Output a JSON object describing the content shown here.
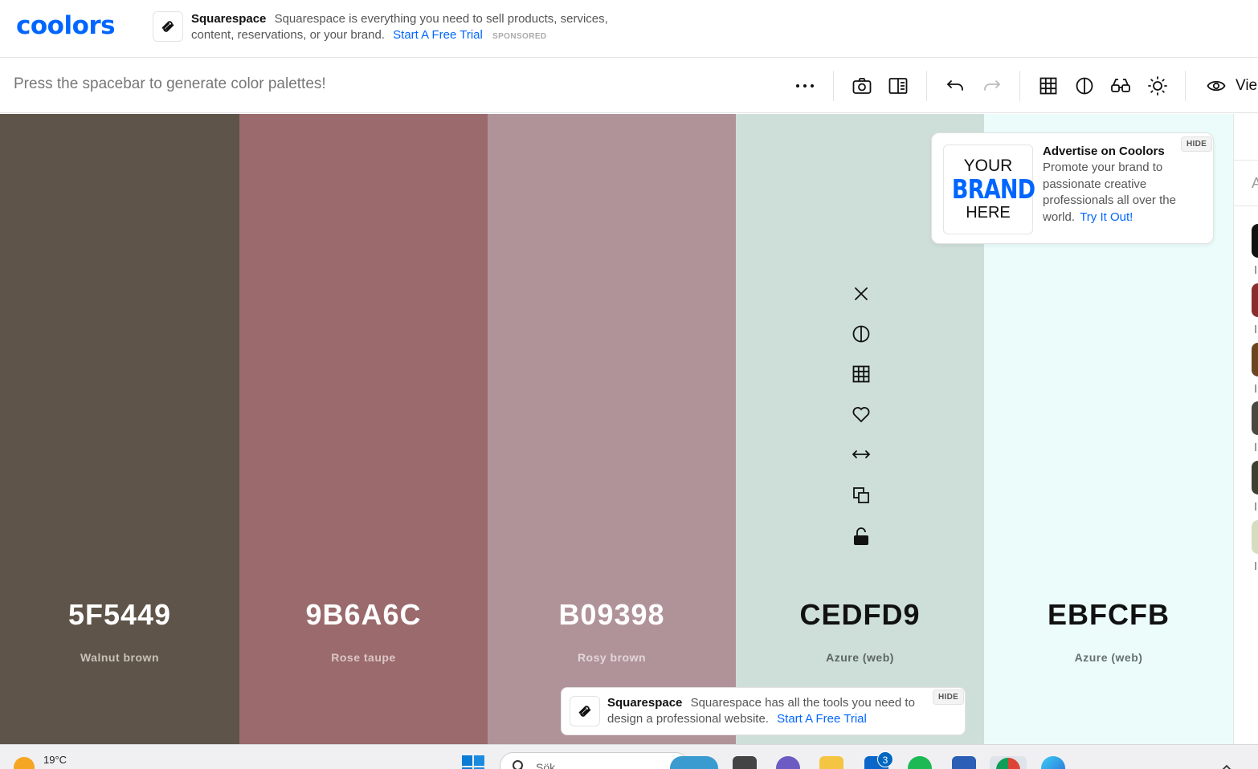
{
  "header": {
    "logo": "coolors",
    "ad": {
      "brand": "Squarespace",
      "text": "Squarespace is everything you need to sell products, services, content, reservations, or your brand.",
      "cta": "Start A Free Trial",
      "sponsored": "SPONSORED"
    }
  },
  "toolbar": {
    "hint": "Press the spacebar to generate color palettes!",
    "icons": [
      "more-icon",
      "camera-icon",
      "split-view-icon",
      "undo-icon",
      "redo-icon",
      "grid-icon",
      "contrast-icon",
      "glasses-icon",
      "sun-icon",
      "eye-icon"
    ],
    "view_label": "Vie"
  },
  "palette": [
    {
      "hex": "5F5449",
      "name": "Walnut brown",
      "color": "#5F5449",
      "text_color": "#ffffff",
      "name_color": "#c9c2bb"
    },
    {
      "hex": "9B6A6C",
      "name": "Rose taupe",
      "color": "#9B6A6C",
      "text_color": "#ffffff",
      "name_color": "#dcc6c7"
    },
    {
      "hex": "B09398",
      "name": "Rosy brown",
      "color": "#B09398",
      "text_color": "#ffffff",
      "name_color": "#e2d6d8"
    },
    {
      "hex": "CEDFD9",
      "name": "Azure (web)",
      "color": "#CEDFD9",
      "text_color": "#111111",
      "name_color": "#5c6662"
    },
    {
      "hex": "EBFCFB",
      "name": "Azure (web)",
      "color": "#EBFCFB",
      "text_color": "#111111",
      "name_color": "#667170"
    }
  ],
  "swatch_tools": [
    "close-icon",
    "contrast-icon",
    "shades-grid-icon",
    "heart-icon",
    "drag-icon",
    "copy-icon",
    "unlock-icon"
  ],
  "advertise": {
    "brand_line1": "YOUR",
    "brand_line2": "BRAND",
    "brand_line3": "HERE",
    "title": "Advertise on Coolors",
    "body": "Promote your brand to passionate creative professionals all over the world.",
    "cta": "Try It Out!",
    "hide": "HIDE"
  },
  "bottom_ad": {
    "brand": "Squarespace",
    "text": "Squarespace has all the tools you need to design a professional website.",
    "cta": "Start A Free Trial",
    "hide": "HIDE"
  },
  "right_panel": {
    "letter": "A",
    "swatches": [
      "#111111",
      "#8b2d2d",
      "#6b4420",
      "#4a4840",
      "#3d3f30",
      "#d6dcbf"
    ]
  },
  "taskbar": {
    "temperature": "19°C",
    "search_placeholder": "Sök",
    "mail_badge": "3"
  }
}
